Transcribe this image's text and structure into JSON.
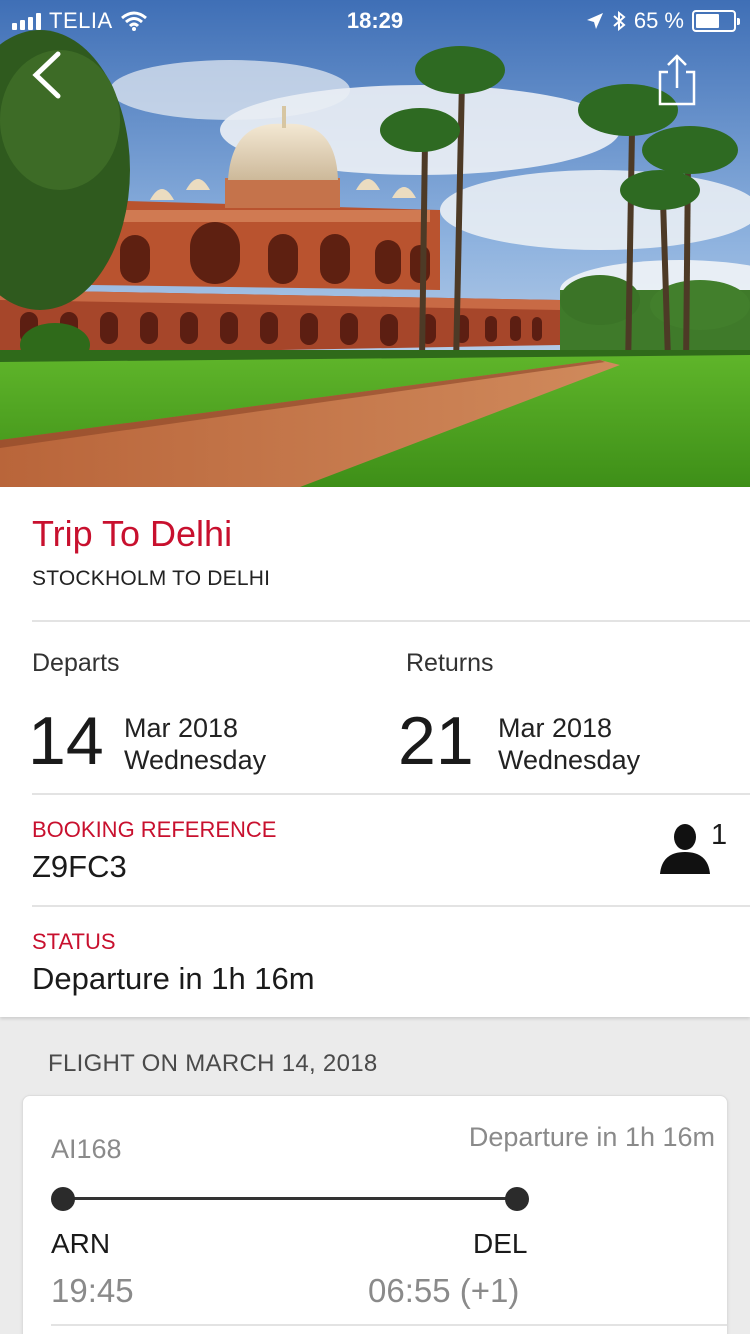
{
  "status_bar": {
    "carrier": "TELIA",
    "time": "18:29",
    "battery": "65 %",
    "battery_level": 0.65
  },
  "header": {
    "back_icon": "chevron-left-icon",
    "share_icon": "share-icon"
  },
  "trip": {
    "title": "Trip To Delhi",
    "route": "STOCKHOLM TO DELHI",
    "departs": {
      "label": "Departs",
      "day": "14",
      "month": "Mar 2018",
      "weekday": "Wednesday"
    },
    "returns": {
      "label": "Returns",
      "day": "21",
      "month": "Mar 2018",
      "weekday": "Wednesday"
    },
    "booking_ref_label": "BOOKING REFERENCE",
    "booking_ref": "Z9FC3",
    "passenger_count": "1",
    "status_label": "STATUS",
    "status": "Departure in 1h 16m"
  },
  "flight_section": {
    "header": "FLIGHT ON MARCH 14, 2018",
    "flight_number": "AI168",
    "status": "Departure in 1h 16m",
    "origin": "ARN",
    "destination": "DEL",
    "departure_time": "19:45",
    "arrival_time": "06:55 (+1)"
  },
  "colors": {
    "accent": "#c8102e",
    "text": "#1a1a1a",
    "muted": "#8a8a8a",
    "background": "#ebebeb"
  }
}
